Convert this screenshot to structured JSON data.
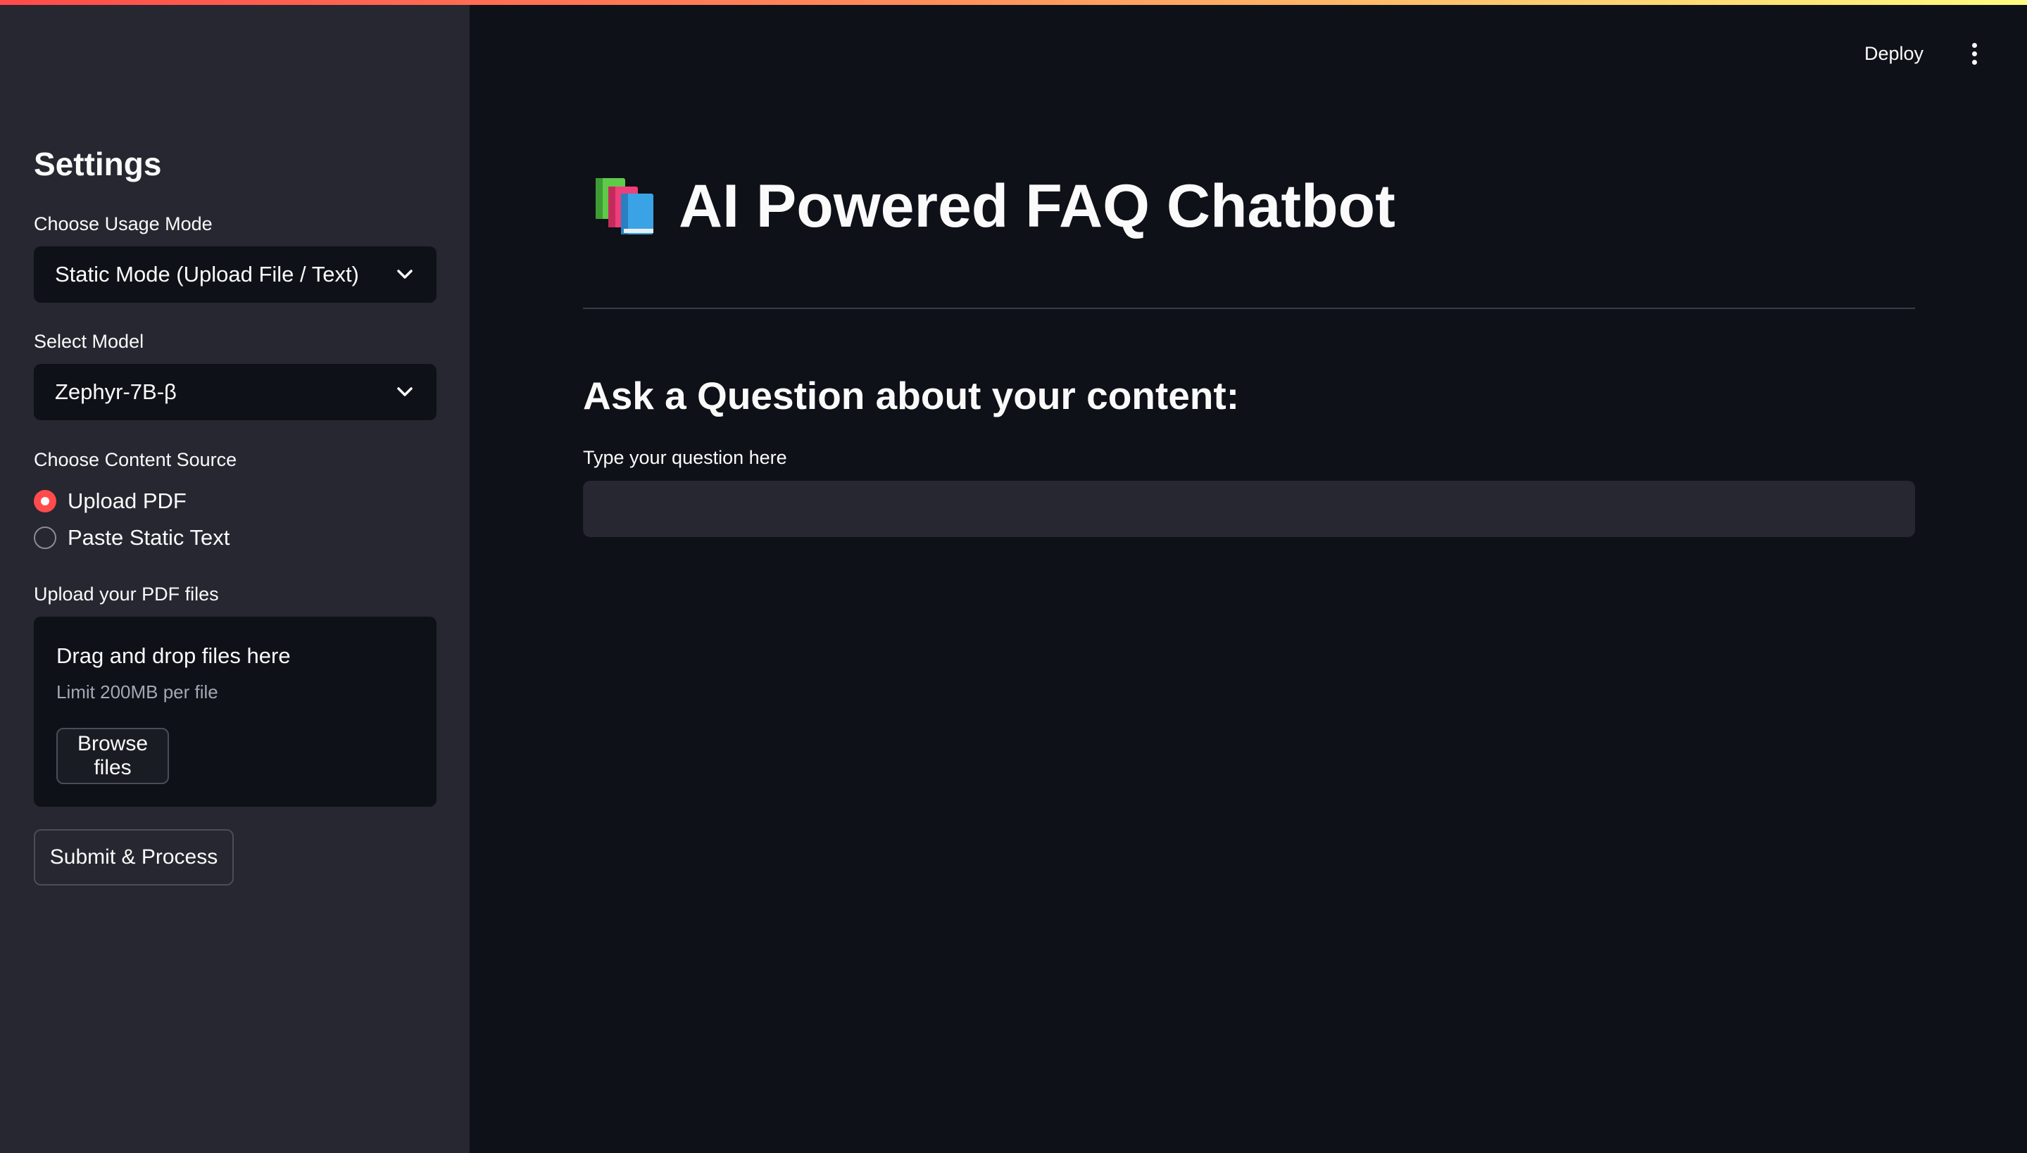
{
  "header": {
    "deploy_label": "Deploy",
    "menu_icon": "kebab-menu-icon",
    "accent_gradient": [
      "#ff4b4b",
      "#fffd80"
    ]
  },
  "sidebar": {
    "title": "Settings",
    "usage_mode": {
      "label": "Choose Usage Mode",
      "value": "Static Mode (Upload File / Text)"
    },
    "model": {
      "label": "Select Model",
      "value": "Zephyr-7B-β"
    },
    "content_source": {
      "label": "Choose Content Source",
      "options": [
        {
          "label": "Upload PDF",
          "selected": true
        },
        {
          "label": "Paste Static Text",
          "selected": false
        }
      ]
    },
    "uploader": {
      "label": "Upload your PDF files",
      "drop_text": "Drag and drop files here",
      "limit_text": "Limit 200MB per file",
      "browse_label": "Browse files"
    },
    "submit_label": "Submit & Process"
  },
  "main": {
    "title_icon": "books-icon",
    "title": "AI Powered FAQ Chatbot",
    "section_title": "Ask a Question about your content:",
    "question": {
      "label": "Type your question here",
      "value": ""
    }
  },
  "colors": {
    "background": "#0e1117",
    "sidebar": "#262730",
    "accent": "#ff4b4b",
    "text": "#fafafa"
  }
}
